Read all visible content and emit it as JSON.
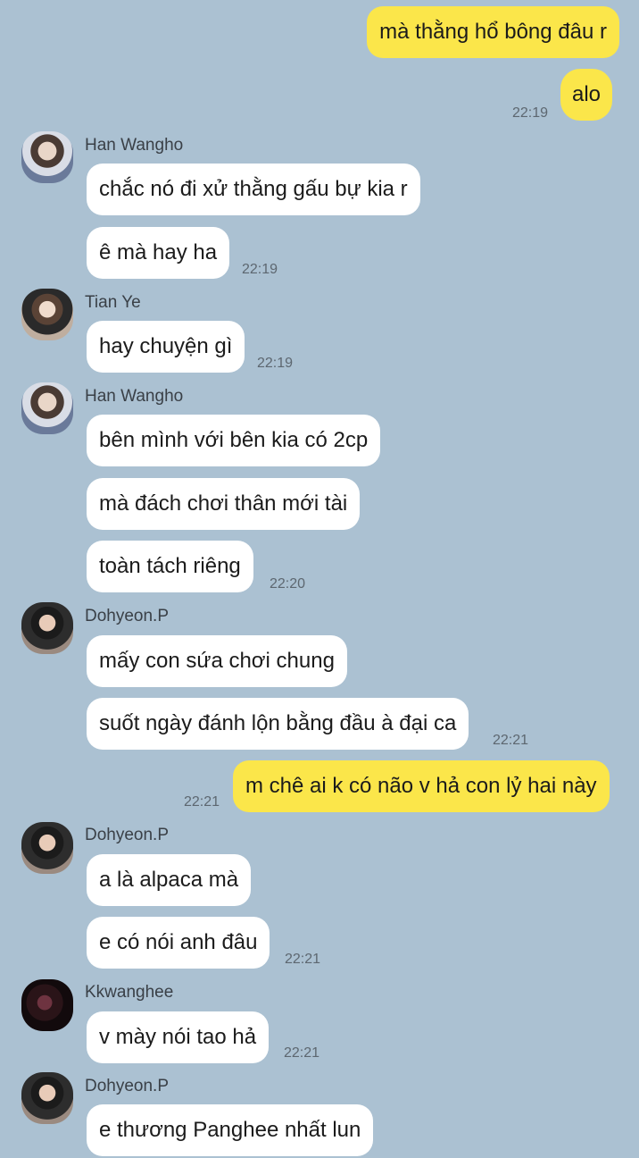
{
  "messages": [
    {
      "kind": "out",
      "text": "mà thằng hổ bông đâu r"
    },
    {
      "kind": "out",
      "text": "alo",
      "time": "22:19"
    },
    {
      "kind": "in",
      "sender": "Han Wangho",
      "avatar": "han-wangho-avatar",
      "text": "chắc nó đi xử thằng gấu bự kia r"
    },
    {
      "kind": "in",
      "text": "ê mà hay ha",
      "time": "22:19"
    },
    {
      "kind": "in",
      "sender": "Tian Ye",
      "avatar": "tian-ye-avatar",
      "text": "hay chuyện gì",
      "time": "22:19"
    },
    {
      "kind": "in",
      "sender": "Han Wangho",
      "avatar": "han-wangho-avatar",
      "text": "bên mình với bên kia có 2cp"
    },
    {
      "kind": "in",
      "text": "mà đách chơi thân mới tài"
    },
    {
      "kind": "in",
      "text": "toàn tách riêng",
      "time": "22:20"
    },
    {
      "kind": "in",
      "sender": "Dohyeon.P",
      "avatar": "dohyeon-avatar",
      "text": "mấy con sứa chơi chung"
    },
    {
      "kind": "in",
      "text": "suốt ngày đánh lộn bằng đầu à đại ca",
      "time": "22:21"
    },
    {
      "kind": "out",
      "text": "m chê ai k có não v hả con lỷ hai này",
      "time": "22:21"
    },
    {
      "kind": "in",
      "sender": "Dohyeon.P",
      "avatar": "dohyeon-avatar",
      "text": "a là alpaca mà"
    },
    {
      "kind": "in",
      "text": "e có nói anh đâu",
      "time": "22:21"
    },
    {
      "kind": "in",
      "sender": "Kkwanghee",
      "avatar": "kkwanghee-avatar",
      "text": "v mày nói tao hả",
      "time": "22:21"
    },
    {
      "kind": "in",
      "sender": "Dohyeon.P",
      "avatar": "dohyeon-avatar",
      "text": "e thương Panghee nhất lun"
    }
  ],
  "colors": {
    "background": "#abc1d2",
    "outgoing_bubble": "#fbe64a",
    "incoming_bubble": "#ffffff"
  }
}
